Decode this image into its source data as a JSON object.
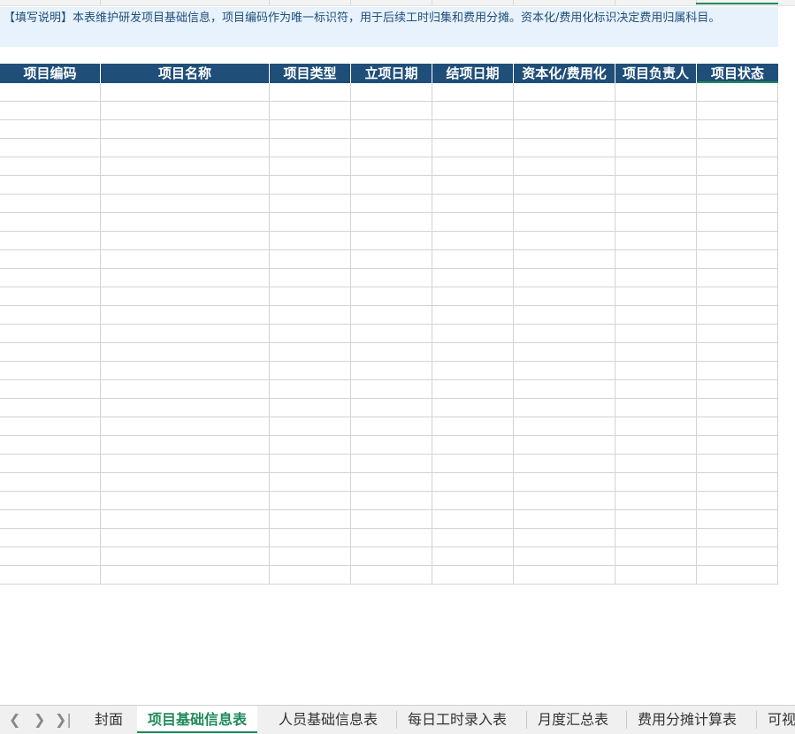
{
  "instructions": {
    "text": "【填写说明】本表维护研发项目基础信息，项目编码作为唯一标识符，用于后续工时归集和费用分摊。资本化/费用化标识决定费用归属科目。"
  },
  "table": {
    "headers": [
      "项目编码",
      "项目名称",
      "项目类型",
      "立项日期",
      "结项日期",
      "资本化/费用化",
      "项目负责人",
      "项目状态"
    ],
    "empty_rows": 27
  },
  "sheet_tabs": {
    "tabs": [
      "封面",
      "项目基础信息表",
      "人员基础信息表",
      "每日工时录入表",
      "月度汇总表",
      "费用分摊计算表",
      "可视"
    ],
    "active": "项目基础信息表"
  },
  "icons": {
    "prev": "chevron-left-icon",
    "next": "chevron-right-icon",
    "last": "chevron-last-icon"
  },
  "colors": {
    "header_bg": "#1f4e79",
    "note_bg": "#e8f2fc",
    "accent": "#1f8a5a"
  }
}
